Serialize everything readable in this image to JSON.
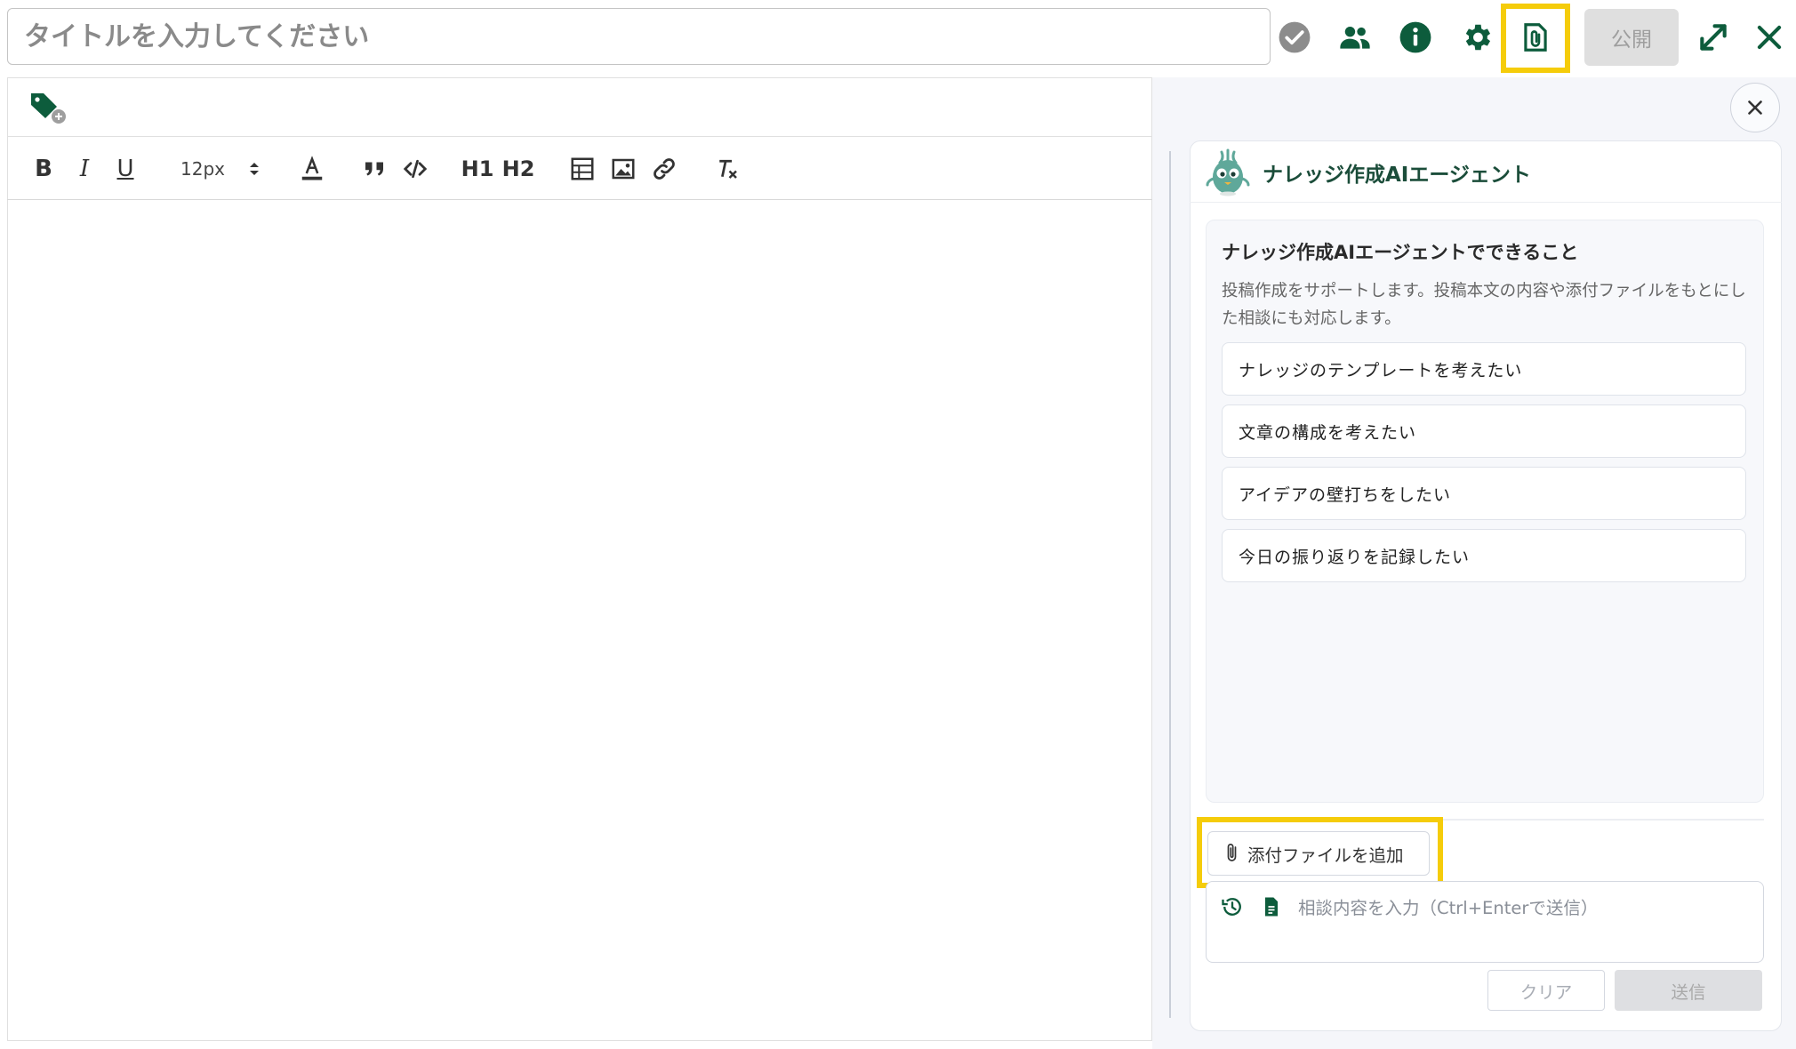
{
  "header": {
    "title_placeholder": "タイトルを入力してください",
    "publish_label": "公開",
    "icons": [
      "check-circle-icon",
      "users-icon",
      "info-icon",
      "gear-icon",
      "paperclip-file-icon",
      "expand-icon",
      "close-icon"
    ]
  },
  "editor": {
    "toolbar": {
      "font_size": "12px",
      "icons": [
        "bold-icon",
        "italic-icon",
        "underline-icon",
        "font-size-stepper-icon",
        "text-color-icon",
        "quote-icon",
        "code-icon",
        "heading1-icon",
        "heading2-icon",
        "table-icon",
        "image-icon",
        "link-icon",
        "clear-format-icon"
      ],
      "bold_label": "B",
      "italic_label": "I",
      "underline_label": "U",
      "h1_label": "H1",
      "h2_label": "H2"
    }
  },
  "agent": {
    "title": "ナレッジ作成AIエージェント",
    "info_title": "ナレッジ作成AIエージェントでできること",
    "info_desc": "投稿作成をサポートします。投稿本文の内容や添付ファイルをもとにした相談にも対応します。",
    "suggestions": [
      "ナレッジのテンプレートを考えたい",
      "文章の構成を考えたい",
      "アイデアの壁打ちをしたい",
      "今日の振り返りを記録したい"
    ],
    "attach_label": "添付ファイルを追加",
    "input_placeholder": "相談内容を入力（Ctrl+Enterで送信）",
    "clear_label": "クリア",
    "send_label": "送信"
  },
  "colors": {
    "accent_green": "#0d5c3c",
    "highlight_yellow": "#f5cc0a"
  }
}
